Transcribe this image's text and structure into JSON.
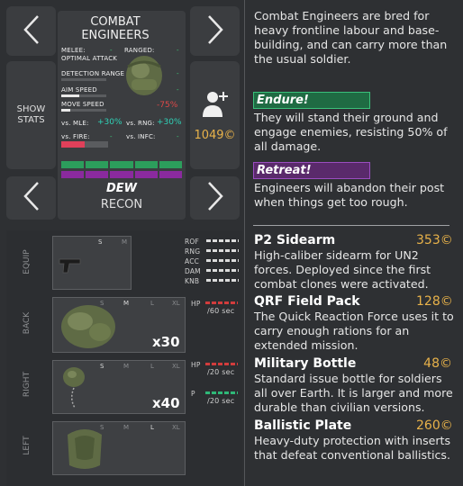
{
  "unit": {
    "name": "COMBAT ENGINEERS",
    "soldier_name": "DEW",
    "role": "RECON",
    "cost": "1049©",
    "description": "Combat Engineers are bred for heavy frontline labour and base-building, and can carry more than the usual soldier."
  },
  "stats": {
    "melee": "MELEE:",
    "melee_val": "-",
    "ranged": "RANGED:",
    "ranged_val": "-",
    "optimal_attack": "OPTIMAL ATTACK",
    "detection_range": "DETECTION RANGE",
    "detection_val": "-",
    "aim_speed": "AIM SPEED",
    "aim_val": "-",
    "move_speed": "MOVE SPEED",
    "move_val": "-75%",
    "vs_mle": "vs. MLE:",
    "vs_mle_val": "+30%",
    "vs_rng": "vs. RNG:",
    "vs_rng_val": "+30%",
    "vs_fire": "vs. FIRE:",
    "vs_fire_val": "-",
    "vs_infc": "vs. INFC:",
    "vs_infc_val": "-",
    "aim_speed_level": 0.4,
    "move_speed_level": 0.2,
    "fire_level": 0.5
  },
  "buttons": {
    "show_stats": "SHOW\nSTATS"
  },
  "abilities": [
    {
      "name": "Endure!",
      "color": "#1f6b43",
      "border": "#3ac07a",
      "description": "They will stand their ground and engage enemies, resisting 50% of all damage."
    },
    {
      "name": "Retreat!",
      "color": "#5a2a6b",
      "border": "#9a4dc0",
      "description": "Engineers will abandon their post when things get too rough."
    }
  ],
  "slots": {
    "equip": {
      "label": "EQUIP",
      "sizes": [
        "S",
        "M"
      ]
    },
    "back": {
      "label": "BACK",
      "sizes": [
        "S",
        "M",
        "L",
        "XL"
      ],
      "count": "x30"
    },
    "right": {
      "label": "RIGHT",
      "sizes": [
        "S",
        "M",
        "L",
        "XL"
      ],
      "count": "x40"
    },
    "left": {
      "label": "LEFT",
      "sizes": [
        "S",
        "M",
        "L",
        "XL"
      ]
    }
  },
  "weapon_stats": [
    "ROF",
    "RNG",
    "ACC",
    "DAM",
    "KNB"
  ],
  "back_effects": {
    "hp": "HP",
    "time": "/60 sec"
  },
  "right_effects": {
    "hp": "HP",
    "hp_time": "/20 sec",
    "p": "P",
    "p_time": "/20 sec"
  },
  "items": [
    {
      "name": "P2 Sidearm",
      "price": "353©",
      "description": "High-caliber sidearm for UN2 forces. Deployed since the first combat clones were activated."
    },
    {
      "name": "QRF Field Pack",
      "price": "128©",
      "description": "The Quick Reaction Force uses it to carry enough rations for an extended mission."
    },
    {
      "name": "Military Bottle",
      "price": "48©",
      "description": "Standard issue bottle for soldiers all over Earth. It is larger and more durable than civilian versions."
    },
    {
      "name": "Ballistic Plate",
      "price": "260©",
      "description": "Heavy-duty protection with inserts that defeat conventional ballistics."
    }
  ],
  "colors": {
    "green_bar": "#2c9e5c",
    "purple_bar": "#8a2a9e",
    "price": "#e8b24a",
    "red": "#e04848"
  }
}
